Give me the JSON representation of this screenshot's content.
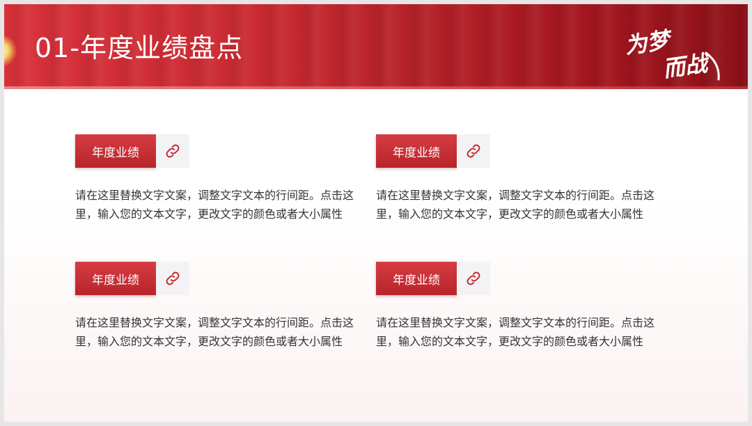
{
  "slide": {
    "title": "01-年度业绩盘点",
    "slogan": "为梦而战"
  },
  "blocks": [
    {
      "label": "年度业绩",
      "icon": "link-icon",
      "text": "请在这里替换文字文案，调整文字文本的行间距。点击这里，输入您的文本文字，更改文字的颜色或者大小属性"
    },
    {
      "label": "年度业绩",
      "icon": "link-icon",
      "text": "请在这里替换文字文案，调整文字文本的行间距。点击这里，输入您的文本文字，更改文字的颜色或者大小属性"
    },
    {
      "label": "年度业绩",
      "icon": "link-icon",
      "text": "请在这里替换文字文案，调整文字文本的行间距。点击这里，输入您的文本文字，更改文字的颜色或者大小属性"
    },
    {
      "label": "年度业绩",
      "icon": "link-icon",
      "text": "请在这里替换文字文案，调整文字文本的行间距。点击这里，输入您的文本文字，更改文字的颜色或者大小属性"
    }
  ],
  "colors": {
    "brand_red": "#c3282f",
    "text": "#333333",
    "icon_bg": "#f3f3f5"
  }
}
